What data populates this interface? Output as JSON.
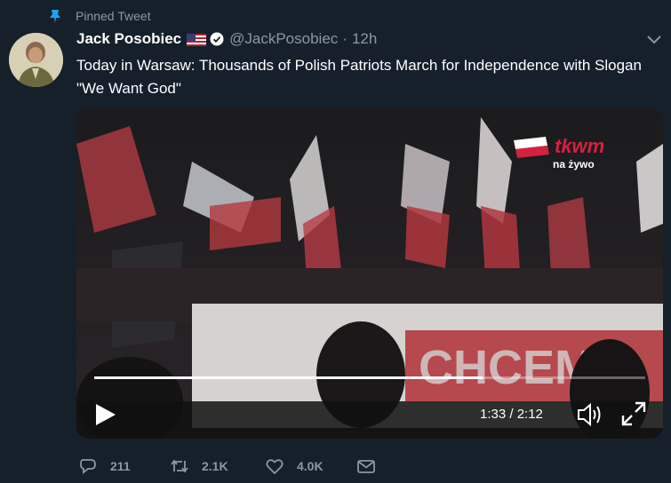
{
  "pinned": {
    "label": "Pinned Tweet",
    "icon": "pin-icon"
  },
  "author": {
    "name": "Jack Posobiec",
    "handle": "@JackPosobiec",
    "timestamp": "12h",
    "separator": "·",
    "flag_icon": "us-flag-icon",
    "verified_icon": "verified-badge-icon"
  },
  "tweet": {
    "text": "Today in Warsaw: Thousands of Polish Patriots March for Independence with Slogan \"We Want God\""
  },
  "video": {
    "time_readout": "1:33 / 2:12",
    "progress_fraction": 0.705,
    "channel_logo_text": "tkwm",
    "channel_sub": "na żywo"
  },
  "actions": {
    "reply_count": "211",
    "retweet_count": "2.1K",
    "like_count": "4.0K"
  },
  "colors": {
    "background": "#15202b",
    "secondary_text": "#8899a6",
    "accent": "#1da1f2"
  }
}
